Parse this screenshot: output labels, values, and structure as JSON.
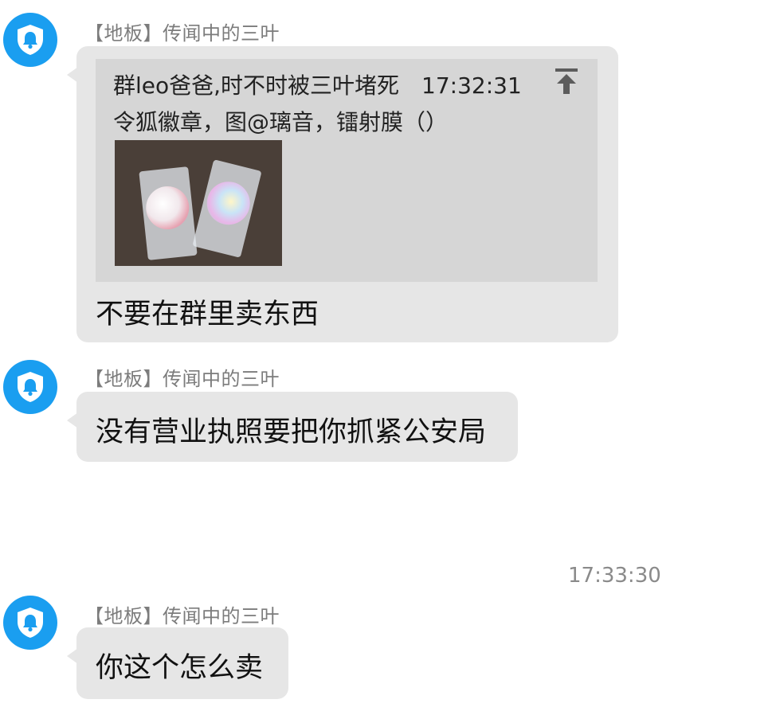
{
  "messages": [
    {
      "sender": "【地板】传闻中的三叶",
      "quote": {
        "header": "群leo爸爸,时不时被三叶堵死　17:32:31",
        "text": "令狐徽章，图@璃音，镭射膜（）",
        "image_icon": "up-arrow-icon"
      },
      "text": "不要在群里卖东西"
    },
    {
      "sender": "【地板】传闻中的三叶",
      "text": "没有营业执照要把你抓紧公安局"
    },
    {
      "sender": "【地板】传闻中的三叶",
      "text": "你这个怎么卖"
    }
  ],
  "timestamp": "17:33:30",
  "colors": {
    "avatar": "#1a9ef0",
    "bubble": "#e6e6e6",
    "quote_bg": "#d6d6d6",
    "sender_text": "#7c7c7c",
    "timestamp_text": "#8a8a8a"
  }
}
